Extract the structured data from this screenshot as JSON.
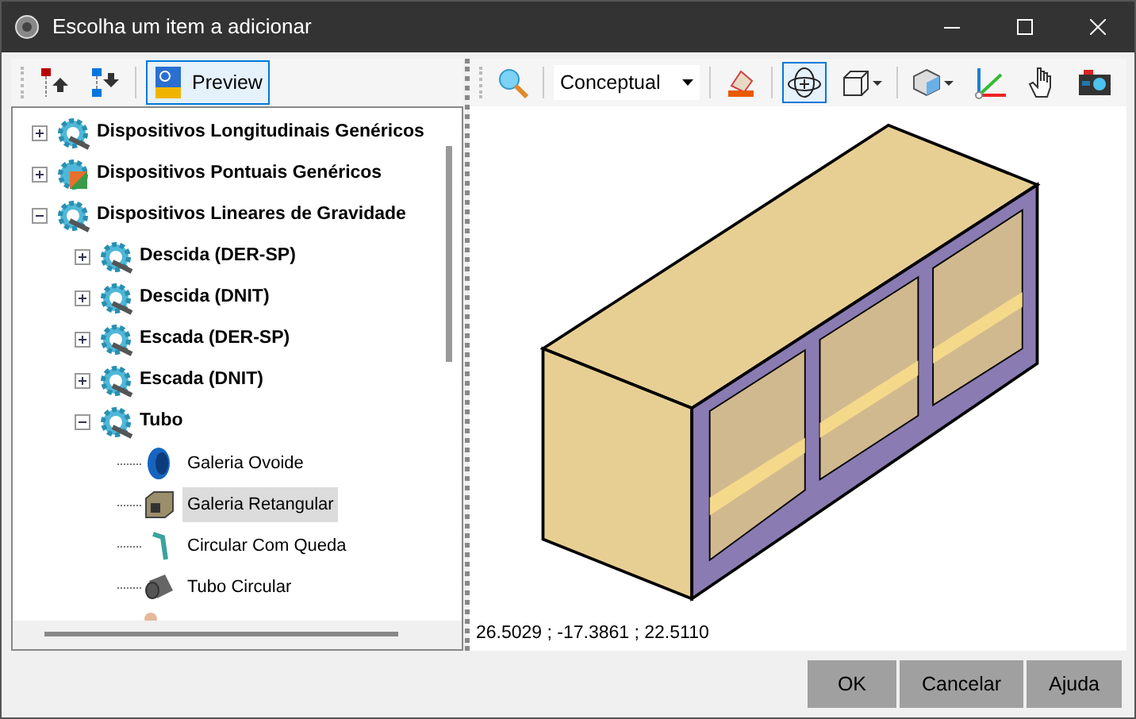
{
  "window": {
    "title": "Escolha um item a adicionar"
  },
  "left_toolbar": {
    "preview_button": {
      "label": "Preview",
      "selected": true
    }
  },
  "tree": [
    {
      "label": "Dispositivos Longitudinais Genéricos",
      "kind": "gear",
      "expanded": false
    },
    {
      "label": "Dispositivos Pontuais Genéricos",
      "kind": "gearbox",
      "expanded": false
    },
    {
      "label": "Dispositivos Lineares de Gravidade",
      "kind": "gear",
      "expanded": true,
      "children": [
        {
          "label": "Descida (DER-SP)",
          "kind": "gear",
          "expanded": false
        },
        {
          "label": "Descida (DNIT)",
          "kind": "gear",
          "expanded": false
        },
        {
          "label": "Escada (DER-SP)",
          "kind": "gear",
          "expanded": false
        },
        {
          "label": "Escada (DNIT)",
          "kind": "gear",
          "expanded": false
        },
        {
          "label": "Tubo",
          "kind": "gear",
          "expanded": true,
          "children": [
            {
              "label": "Galeria Ovoide",
              "kind": "ring",
              "selected": false
            },
            {
              "label": "Galeria Retangular",
              "kind": "box",
              "selected": true
            },
            {
              "label": "Circular Com Queda",
              "kind": "pipe",
              "selected": false
            },
            {
              "label": "Tubo Circular",
              "kind": "cylinder",
              "selected": false
            },
            {
              "kind": "cone"
            }
          ]
        }
      ]
    }
  ],
  "viewer_toolbar": {
    "visual_style": "Conceptual",
    "orbit_selected": true
  },
  "viewer": {
    "coordinates": "26.5029 ; -17.3861 ; 22.5110"
  },
  "buttons": [
    {
      "label": "OK"
    },
    {
      "label": "Cancelar"
    },
    {
      "label": "Ajuda"
    }
  ]
}
